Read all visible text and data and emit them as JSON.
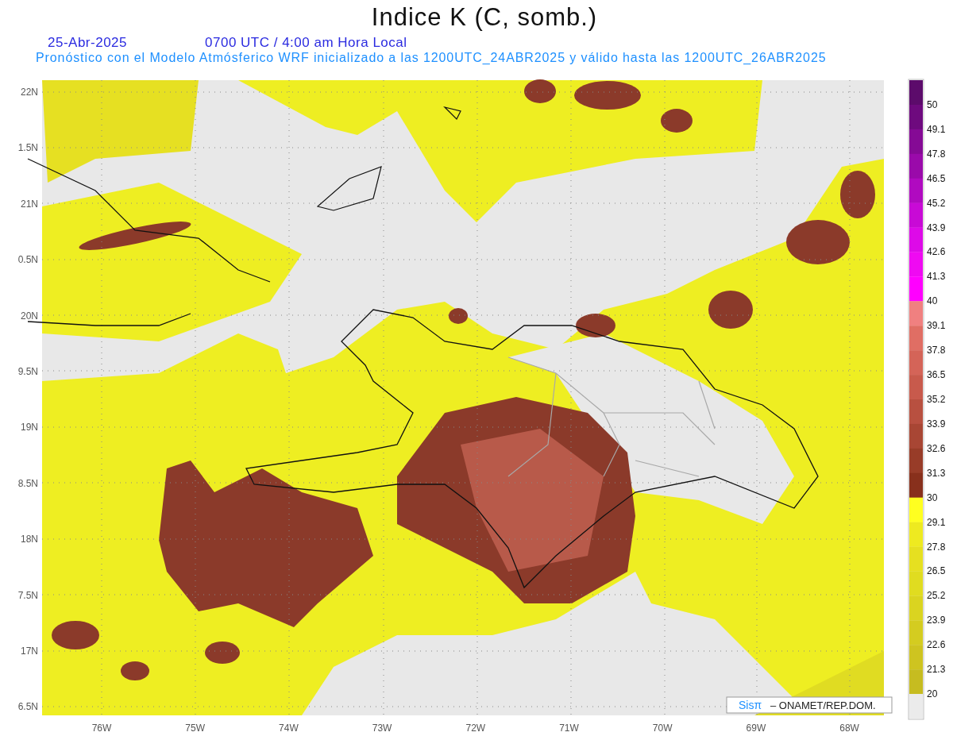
{
  "title": "Indice K (C, somb.)",
  "date": "25-Abr-2025",
  "time": "0700 UTC / 4:00 am Hora Local",
  "subtitle": "Pronóstico con el Modelo Atmósferico WRF inicializado a las 1200UTC_24ABR2025 y válido hasta las 1200UTC_26ABR2025",
  "map": {
    "lat_labels": [
      "22N",
      "1.5N",
      "21N",
      "0.5N",
      "20N",
      "9.5N",
      "19N",
      "8.5N",
      "18N",
      "7.5N",
      "17N",
      "6.5N"
    ],
    "lon_labels": [
      "76W",
      "75W",
      "74W",
      "73W",
      "72W",
      "71W",
      "70W",
      "69W",
      "68W"
    ],
    "credit_logo": "Sisπ",
    "credit_text": "– ONAMET/REP.DOM."
  },
  "colorbar": {
    "segments": [
      {
        "color": "#5c0b6b"
      },
      {
        "color": "#6e0a7e"
      },
      {
        "color": "#850a95"
      },
      {
        "color": "#9a0aaa"
      },
      {
        "color": "#b00ac0"
      },
      {
        "color": "#c80ad6"
      },
      {
        "color": "#dd0ae8"
      },
      {
        "color": "#ef0af2"
      },
      {
        "color": "#ff00ff"
      },
      {
        "color": "#f08080"
      },
      {
        "color": "#e06e64"
      },
      {
        "color": "#d46458"
      },
      {
        "color": "#c85a4c"
      },
      {
        "color": "#b85040"
      },
      {
        "color": "#a84634"
      },
      {
        "color": "#983c28"
      },
      {
        "color": "#88301c"
      },
      {
        "color": "#ffff20"
      },
      {
        "color": "#eeea20"
      },
      {
        "color": "#e6e020"
      },
      {
        "color": "#e0dc20"
      },
      {
        "color": "#dad420"
      },
      {
        "color": "#d4cc20"
      },
      {
        "color": "#cec420"
      },
      {
        "color": "#c6bc20"
      },
      {
        "color": "#ebebeb"
      }
    ],
    "labels": [
      "50",
      "49.1",
      "47.8",
      "46.5",
      "45.2",
      "43.9",
      "42.6",
      "41.3",
      "40",
      "39.1",
      "37.8",
      "36.5",
      "35.2",
      "33.9",
      "32.6",
      "31.3",
      "30",
      "29.1",
      "27.8",
      "26.5",
      "25.2",
      "23.9",
      "22.6",
      "21.3",
      "20"
    ]
  }
}
